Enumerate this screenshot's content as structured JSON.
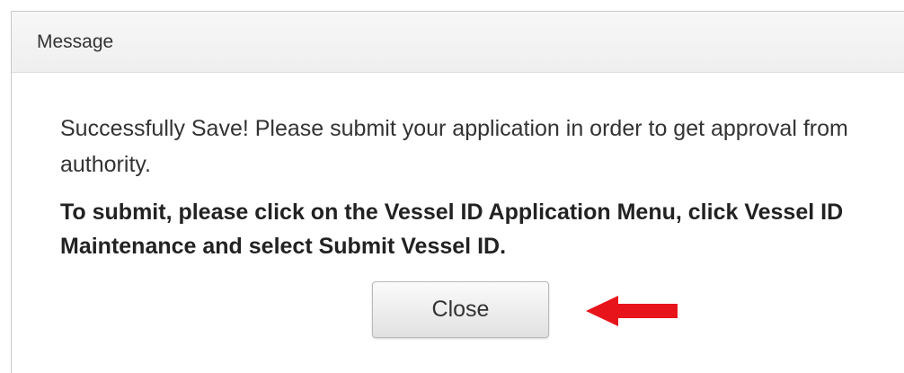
{
  "dialog": {
    "title": "Message",
    "message": "Successfully Save! Please submit your application in order to get approval from authority.",
    "instruction": "To submit, please click on the Vessel ID Application Menu, click Vessel ID Maintenance and select Submit Vessel ID.",
    "close_label": "Close"
  },
  "annotation": {
    "arrow_icon": "red-arrow-left",
    "arrow_color": "#e8141b"
  }
}
